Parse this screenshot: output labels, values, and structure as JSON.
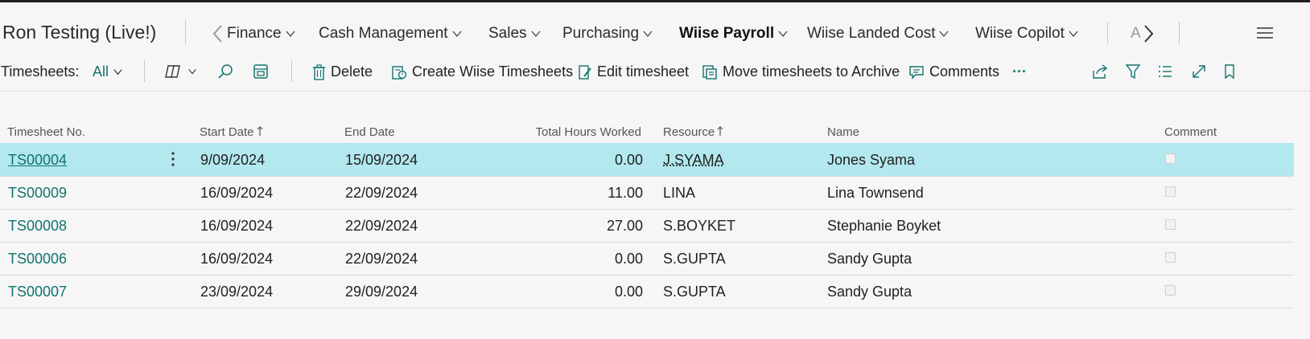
{
  "company": "Ron Testing (Live!)",
  "nav": {
    "items": [
      {
        "label": "Finance",
        "active": false
      },
      {
        "label": "Cash Management",
        "active": false
      },
      {
        "label": "Sales",
        "active": false
      },
      {
        "label": "Purchasing",
        "active": false
      },
      {
        "label": "Wiise Payroll",
        "active": true
      },
      {
        "label": "Wiise Landed Cost",
        "active": false
      },
      {
        "label": "Wiise Copilot",
        "active": false
      },
      {
        "label": "A",
        "active": false
      }
    ]
  },
  "actionbar": {
    "page_label": "Timesheets:",
    "filter_value": "All",
    "delete": "Delete",
    "create": "Create Wiise Timesheets",
    "edit": "Edit timesheet",
    "archive": "Move timesheets to Archive",
    "comments": "Comments",
    "more": "···"
  },
  "table": {
    "headers": {
      "no": "Timesheet No.",
      "start": "Start Date",
      "end": "End Date",
      "hours": "Total Hours Worked",
      "resource": "Resource",
      "name": "Name",
      "comment": "Comment"
    },
    "rows": [
      {
        "no": "TS00004",
        "start": "9/09/2024",
        "end": "15/09/2024",
        "hours": "0.00",
        "resource": "J.SYAMA",
        "name": "Jones Syama",
        "comment": false
      },
      {
        "no": "TS00009",
        "start": "16/09/2024",
        "end": "22/09/2024",
        "hours": "11.00",
        "resource": "LINA",
        "name": "Lina Townsend",
        "comment": false
      },
      {
        "no": "TS00008",
        "start": "16/09/2024",
        "end": "22/09/2024",
        "hours": "27.00",
        "resource": "S.BOYKET",
        "name": "Stephanie Boyket",
        "comment": false
      },
      {
        "no": "TS00006",
        "start": "16/09/2024",
        "end": "22/09/2024",
        "hours": "0.00",
        "resource": "S.GUPTA",
        "name": "Sandy Gupta",
        "comment": false
      },
      {
        "no": "TS00007",
        "start": "23/09/2024",
        "end": "29/09/2024",
        "hours": "0.00",
        "resource": "S.GUPTA",
        "name": "Sandy Gupta",
        "comment": false
      }
    ]
  },
  "colors": {
    "link": "#12746e",
    "selected_row": "#b2e8ee",
    "background": "#f6f6f6"
  }
}
